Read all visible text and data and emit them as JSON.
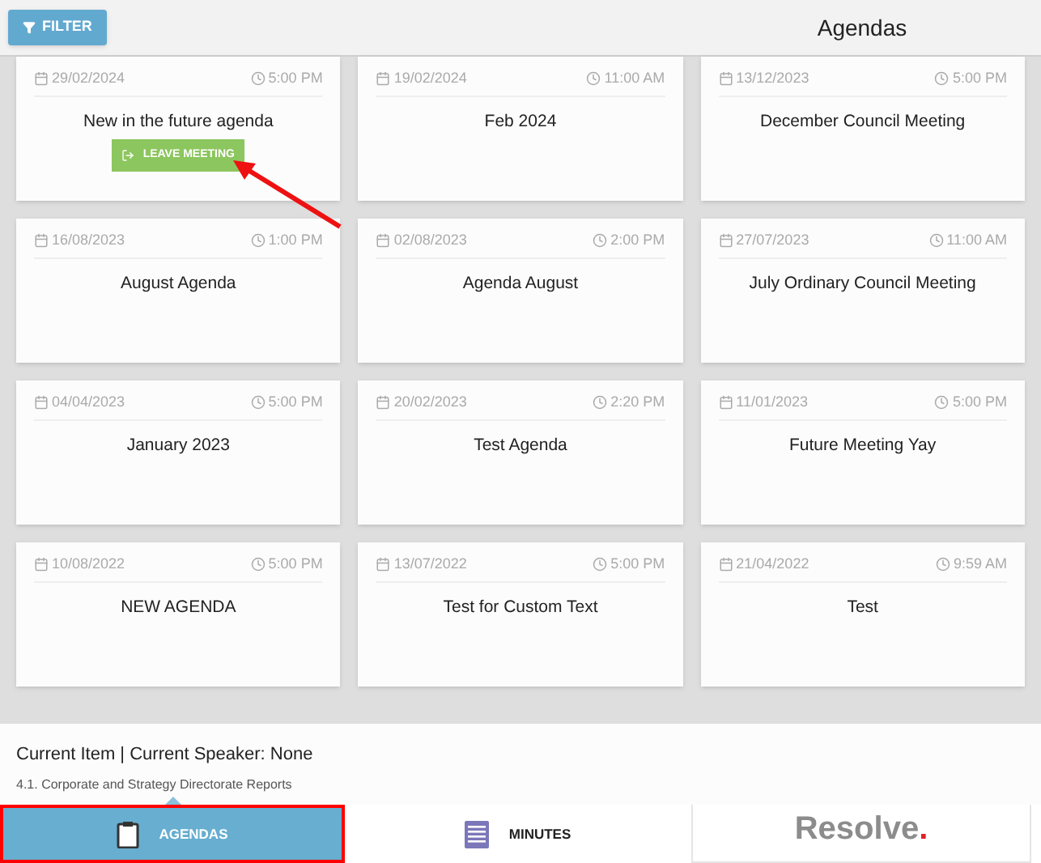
{
  "header": {
    "filter_button": "FILTER",
    "title": "Agendas"
  },
  "cards": [
    {
      "date": "29/02/2024",
      "time": "5:00 PM",
      "title": "New in the future agenda",
      "action": "LEAVE MEETING"
    },
    {
      "date": "19/02/2024",
      "time": "11:00 AM",
      "title": "Feb 2024"
    },
    {
      "date": "13/12/2023",
      "time": "5:00 PM",
      "title": "December Council Meeting"
    },
    {
      "date": "16/08/2023",
      "time": "1:00 PM",
      "title": "August Agenda"
    },
    {
      "date": "02/08/2023",
      "time": "2:00 PM",
      "title": "Agenda August"
    },
    {
      "date": "27/07/2023",
      "time": "11:00 AM",
      "title": "July Ordinary Council Meeting"
    },
    {
      "date": "04/04/2023",
      "time": "5:00 PM",
      "title": "January 2023"
    },
    {
      "date": "20/02/2023",
      "time": "2:20 PM",
      "title": "Test Agenda"
    },
    {
      "date": "11/01/2023",
      "time": "5:00 PM",
      "title": "Future Meeting Yay"
    },
    {
      "date": "10/08/2022",
      "time": "5:00 PM",
      "title": "NEW AGENDA"
    },
    {
      "date": "13/07/2022",
      "time": "5:00 PM",
      "title": "Test for Custom Text"
    },
    {
      "date": "21/04/2022",
      "time": "9:59 AM",
      "title": "Test"
    }
  ],
  "current": {
    "heading": "Current Item | Current Speaker: None",
    "item": "4.1. Corporate and Strategy Directorate Reports"
  },
  "tabs": [
    {
      "label": "AGENDAS",
      "kind": "clipboard",
      "selected": true
    },
    {
      "label": "MINUTES",
      "kind": "document",
      "selected": false
    }
  ],
  "logo": {
    "text": "Resolve",
    "mark": "."
  }
}
